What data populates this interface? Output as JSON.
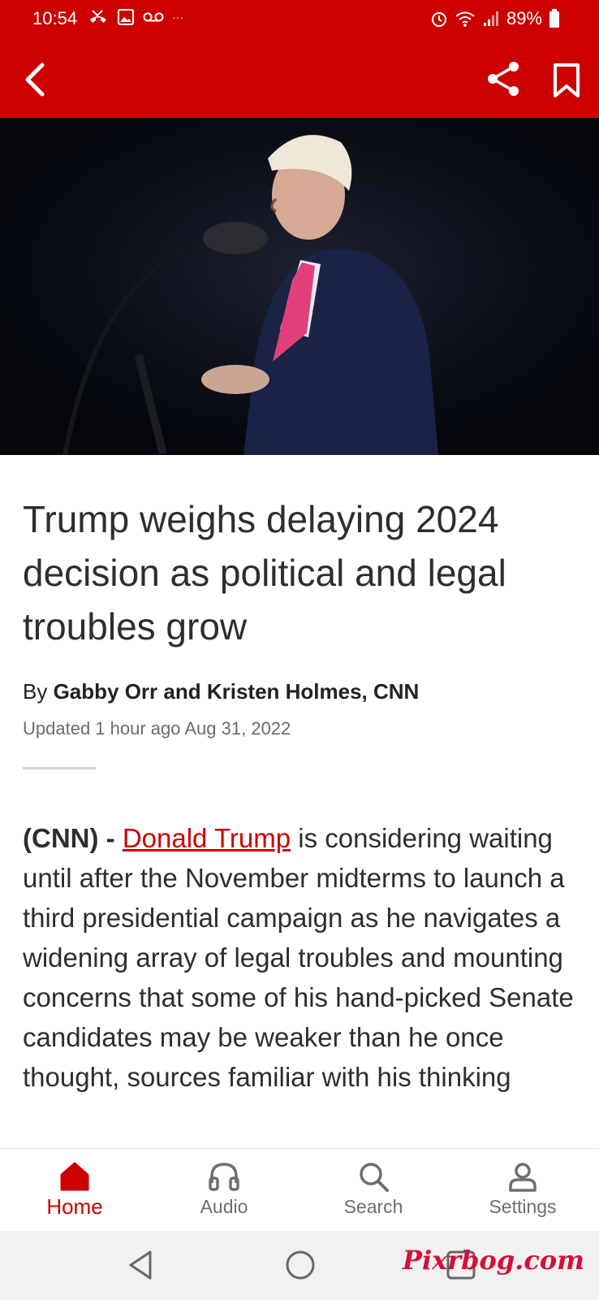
{
  "status_bar": {
    "time": "10:54",
    "left_icons": [
      "missed-call-icon",
      "gallery-icon",
      "voicemail-icon",
      "more-dots-icon"
    ],
    "more": "···",
    "right_icons": [
      "alarm-icon",
      "wifi-icon",
      "signal-icon",
      "battery-icon"
    ],
    "battery": "89%"
  },
  "toolbar": {
    "back_icon": "chevron-left-icon",
    "share_icon": "share-icon",
    "bookmark_icon": "bookmark-icon"
  },
  "article": {
    "headline": "Trump weighs delaying 2024 decision as political and legal troubles grow",
    "byline_prefix": "By",
    "authors": "Gabby Orr and Kristen Holmes, CNN",
    "updated": "Updated 1 hour ago Aug 31, 2022",
    "source": "(CNN) -",
    "link_text": "Donald Trump",
    "body": "is considering waiting until after the November midterms to launch a third presidential campaign as he navigates a widening array of legal troubles and mounting concerns that some of his hand-picked Senate candidates may be weaker than he once thought, sources familiar with his thinking"
  },
  "bottom_nav": {
    "items": [
      {
        "label": "Home",
        "icon": "home-icon",
        "active": true
      },
      {
        "label": "Audio",
        "icon": "headphones-icon",
        "active": false
      },
      {
        "label": "Search",
        "icon": "search-icon",
        "active": false
      },
      {
        "label": "Settings",
        "icon": "person-icon",
        "active": false
      }
    ]
  },
  "system_nav": {
    "buttons": [
      "back-triangle-icon",
      "home-circle-icon",
      "recents-square-icon"
    ]
  },
  "watermark": "Pixrbog.com",
  "colors": {
    "brand_red": "#cc0000",
    "text": "#2e2e2e",
    "muted": "#6b6b6b"
  }
}
